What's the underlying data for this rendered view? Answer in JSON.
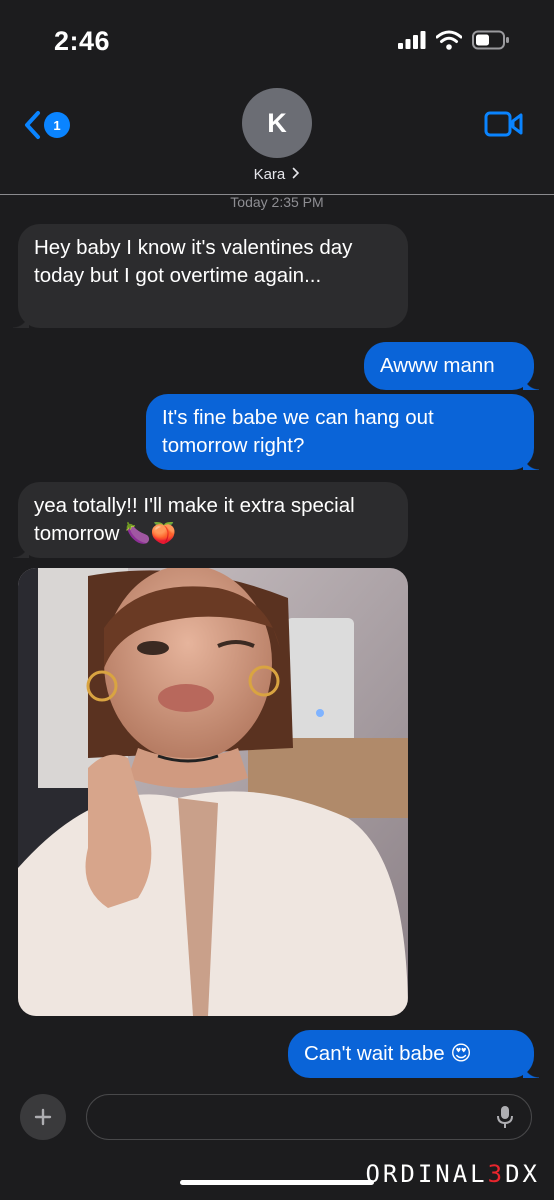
{
  "status_bar": {
    "time": "2:46",
    "icons": [
      "cellular-signal-icon",
      "wifi-icon",
      "battery-icon"
    ]
  },
  "header": {
    "back_badge": "1",
    "avatar_initial": "K",
    "contact_name": "Kara",
    "icons": [
      "back-chevron-icon",
      "chevron-right-icon",
      "video-call-icon"
    ]
  },
  "thread": {
    "timestamp": "Today 2:35 PM",
    "messages": [
      {
        "direction": "incoming",
        "text": "Hey baby I know it's valentines day today but I got overtime again..."
      },
      {
        "direction": "outgoing",
        "text": "Awww mann"
      },
      {
        "direction": "outgoing",
        "text": "It's fine babe we can hang out tomorrow right?"
      },
      {
        "direction": "incoming",
        "text": "yea totally!! I'll make it extra special tomorrow 🍆🍑"
      },
      {
        "direction": "incoming",
        "type": "image",
        "description": "photo attachment"
      },
      {
        "direction": "outgoing",
        "text": "Can't wait babe 😍"
      }
    ]
  },
  "composer": {
    "placeholder": "",
    "icons": [
      "plus-icon",
      "microphone-icon"
    ]
  },
  "watermark": {
    "prefix": "ORDINAL",
    "three": "3",
    "suffix": "DX"
  },
  "colors": {
    "background": "#1c1c1e",
    "incoming_bubble": "#2c2c2e",
    "outgoing_bubble": "#0a64d8",
    "accent": "#0a84ff",
    "watermark_accent": "#e8252d"
  }
}
